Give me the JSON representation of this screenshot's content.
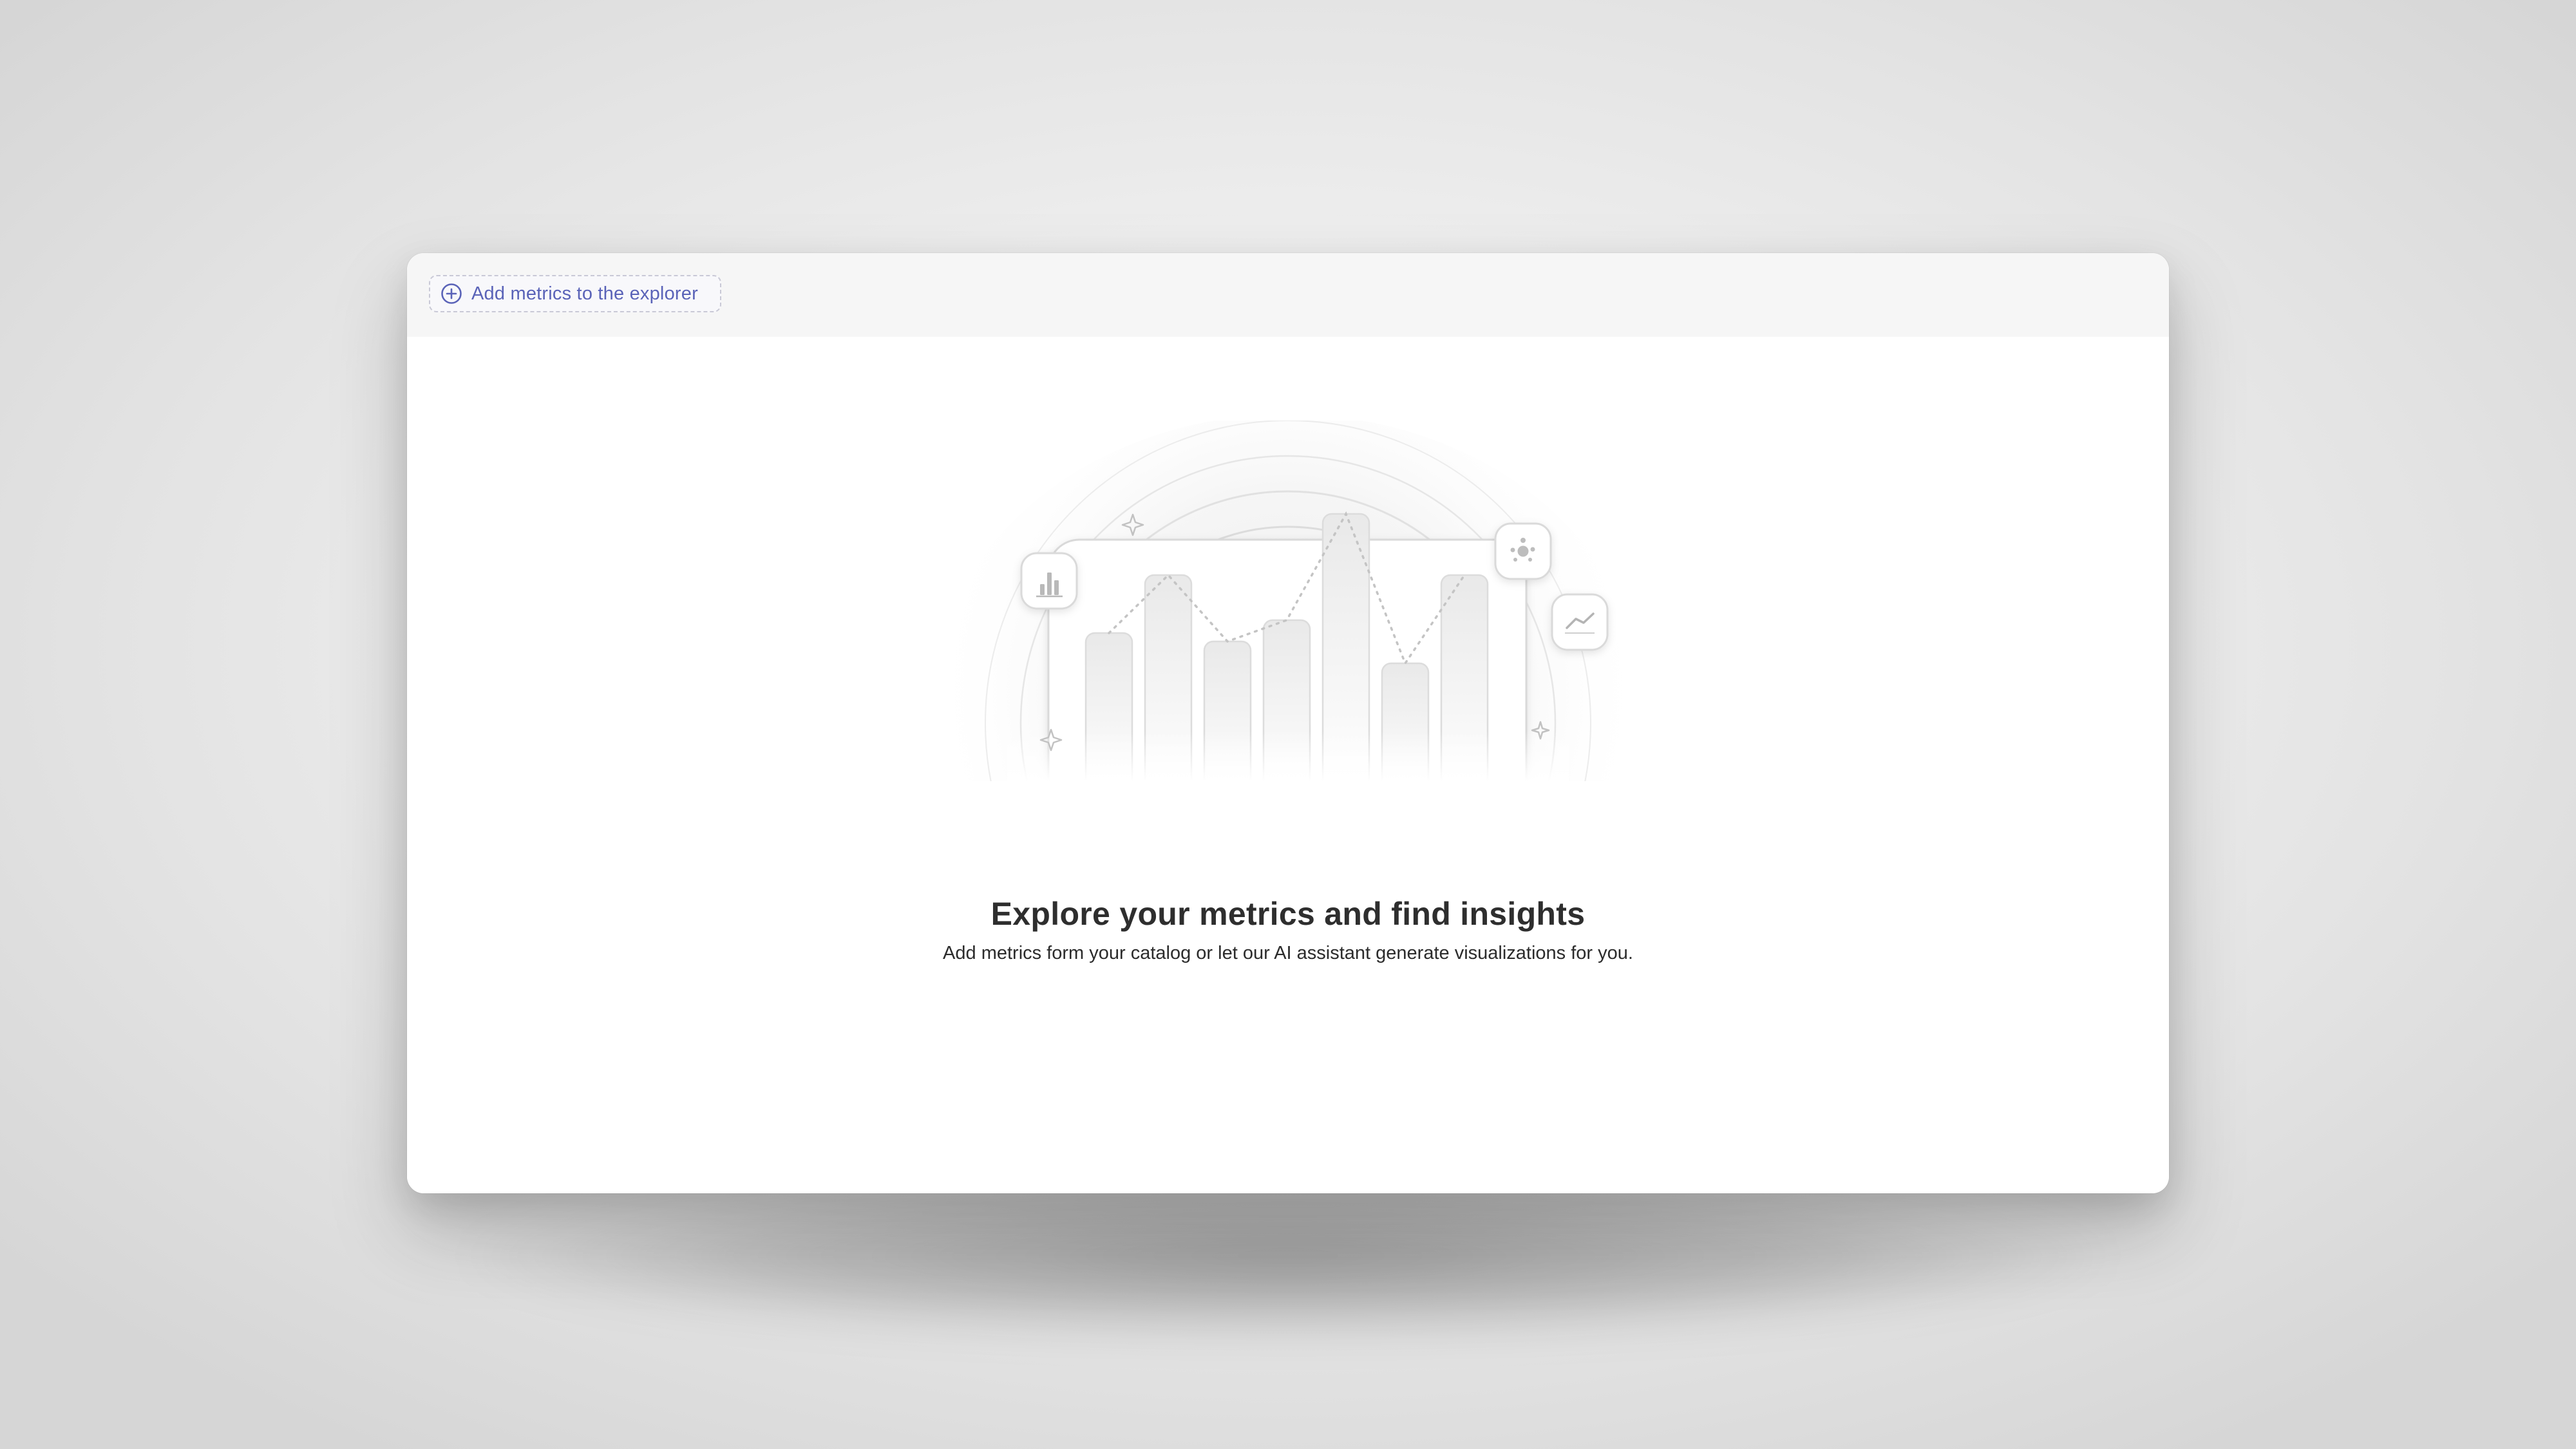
{
  "toolbar": {
    "add_metrics_label": "Add metrics to the explorer",
    "add_icon": "plus-circle-icon"
  },
  "empty_state": {
    "title": "Explore your metrics and find insights",
    "subtitle": "Add metrics form your catalog or let our AI assistant generate visualizations for you.",
    "icons": [
      "bar-chart-icon",
      "scatter-chart-icon",
      "line-chart-icon",
      "sparkle-icon"
    ]
  },
  "colors": {
    "accent": "#5a63b8",
    "title": "#2e2e2e",
    "toolbar_bg": "#f6f6f6"
  }
}
